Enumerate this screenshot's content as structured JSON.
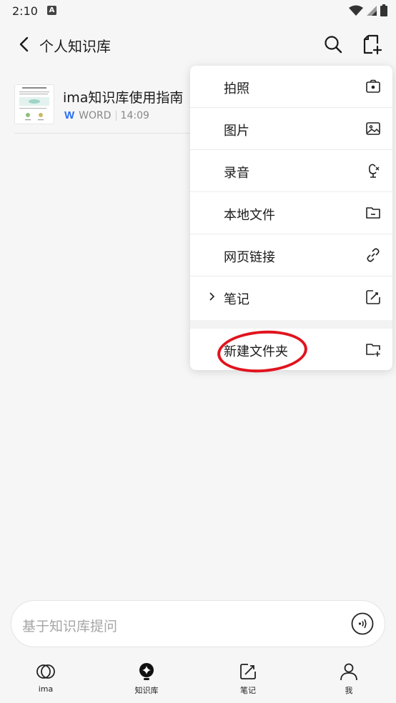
{
  "status_bar": {
    "time": "2:10",
    "notification_glyph": "A"
  },
  "header": {
    "title": "个人知识库"
  },
  "document": {
    "title": "ima知识库使用指南",
    "type": "WORD",
    "time": "14:09",
    "type_icon_glyph": "W"
  },
  "menu": {
    "items": [
      {
        "label": "拍照",
        "icon": "camera-icon"
      },
      {
        "label": "图片",
        "icon": "image-icon"
      },
      {
        "label": "录音",
        "icon": "microphone-icon"
      },
      {
        "label": "本地文件",
        "icon": "folder-file-icon"
      },
      {
        "label": "网页链接",
        "icon": "link-icon"
      },
      {
        "label": "笔记",
        "icon": "note-edit-icon",
        "has_submenu": true
      },
      {
        "label": "新建文件夹",
        "icon": "new-folder-icon",
        "highlighted": true
      }
    ],
    "highlight_color": "#e0141e"
  },
  "ask_bar": {
    "placeholder": "基于知识库提问"
  },
  "tabs": [
    {
      "label": "ima",
      "icon": "ima-logo-icon"
    },
    {
      "label": "知识库",
      "icon": "knowledge-base-icon"
    },
    {
      "label": "笔记",
      "icon": "note-icon"
    },
    {
      "label": "我",
      "icon": "profile-icon"
    }
  ],
  "colors": {
    "accent": "#2b6cf6",
    "background": "#f6f6f6"
  }
}
